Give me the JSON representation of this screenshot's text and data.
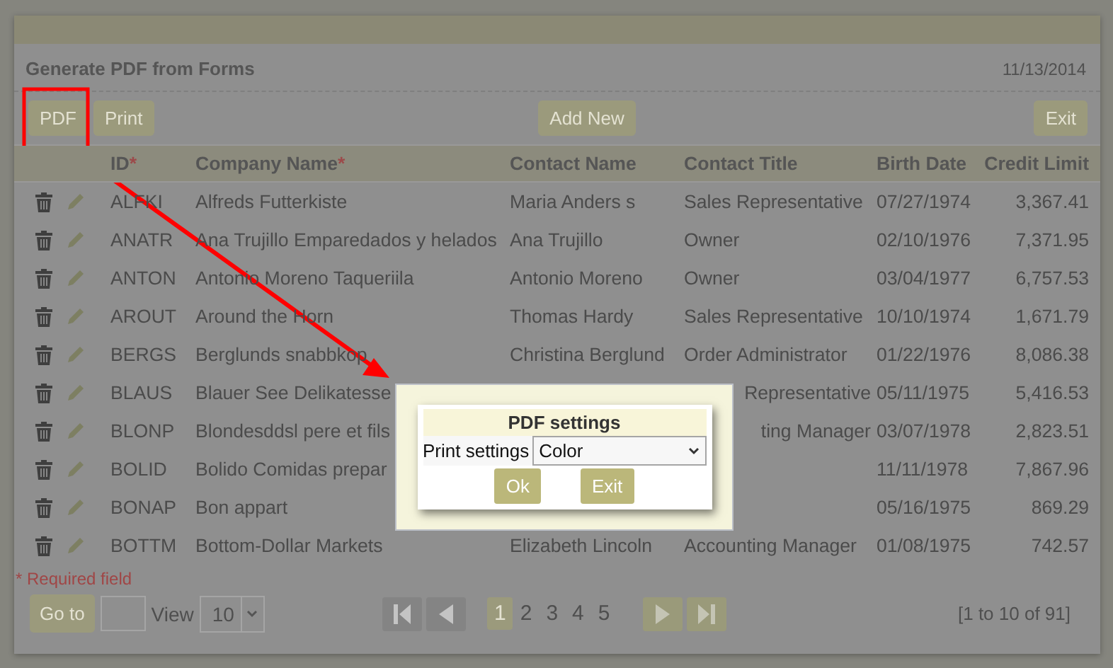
{
  "form": {
    "title": "Generate PDF from Forms",
    "date": "11/13/2014"
  },
  "toolbar": {
    "left": [
      {
        "label": "PDF"
      },
      {
        "label": "Print"
      }
    ],
    "center": [
      {
        "label": "Add New"
      }
    ],
    "right": [
      {
        "label": "Exit"
      }
    ]
  },
  "table": {
    "columns": [
      {
        "label": "ID",
        "mark": "*"
      },
      {
        "label": "Company Name",
        "mark": "*"
      },
      {
        "label": "Contact Name"
      },
      {
        "label": "Contact Title"
      },
      {
        "label": "Birth Date"
      },
      {
        "label": "Credit Limit"
      }
    ],
    "rows": [
      {
        "id": "ALFKI",
        "company": "Alfreds Futterkiste",
        "contact": "Maria Anders s",
        "title": "Sales Representative",
        "birth": "07/27/1974",
        "credit": "3,367.41"
      },
      {
        "id": "ANATR",
        "company": "Ana Trujillo Emparedados y helados",
        "contact": "Ana Trujillo",
        "title": "Owner",
        "birth": "02/10/1976",
        "credit": "7,371.95"
      },
      {
        "id": "ANTON",
        "company": "Antonio Moreno Taqueriila",
        "contact": "Antonio Moreno",
        "title": "Owner",
        "birth": "03/04/1977",
        "credit": "6,757.53"
      },
      {
        "id": "AROUT",
        "company": "Around the Horn",
        "contact": "Thomas Hardy",
        "title": "Sales Representative",
        "birth": "10/10/1974",
        "credit": "1,671.79"
      },
      {
        "id": "BERGS",
        "company": "Berglunds snabbkop",
        "contact": "Christina Berglund",
        "title": "Order Administrator",
        "birth": "01/22/1976",
        "credit": "8,086.38"
      },
      {
        "id": "BLAUS",
        "company": "Blauer See Delikatesse",
        "title_cut": "Representative",
        "birth": "05/11/1975",
        "credit": "5,416.53"
      },
      {
        "id": "BLONP",
        "company": "Blondesddsl pere et fils",
        "title_cut": "ting Manager",
        "birth": "03/07/1978",
        "credit": "2,823.51"
      },
      {
        "id": "BOLID",
        "company": "Bolido Comidas prepar",
        "birth": "11/11/1978",
        "credit": "7,867.96"
      },
      {
        "id": "BONAP",
        "company": "Bon appart",
        "birth": "05/16/1975",
        "credit": "869.29"
      },
      {
        "id": "BOTTM",
        "company": "Bottom-Dollar Markets",
        "contact": "Elizabeth Lincoln",
        "title": "Accounting Manager",
        "birth": "01/08/1975",
        "credit": "742.57"
      }
    ]
  },
  "required_note": "* Required field",
  "pager": {
    "goto": "Go to",
    "view_label": "View",
    "page_size": "10",
    "pages": [
      {
        "label": "1",
        "selected": true
      },
      {
        "label": "2",
        "selected": false
      },
      {
        "label": "3",
        "selected": false
      },
      {
        "label": "4",
        "selected": false
      },
      {
        "label": "5",
        "selected": false
      }
    ],
    "back_disabled": true,
    "forward_disabled": false,
    "summary": "[1 to 10 of 91]"
  },
  "dialog": {
    "title": "PDF settings",
    "field_label": "Print settings",
    "value": "Color",
    "buttons": [
      {
        "label": "Ok"
      },
      {
        "label": "Exit"
      }
    ]
  }
}
